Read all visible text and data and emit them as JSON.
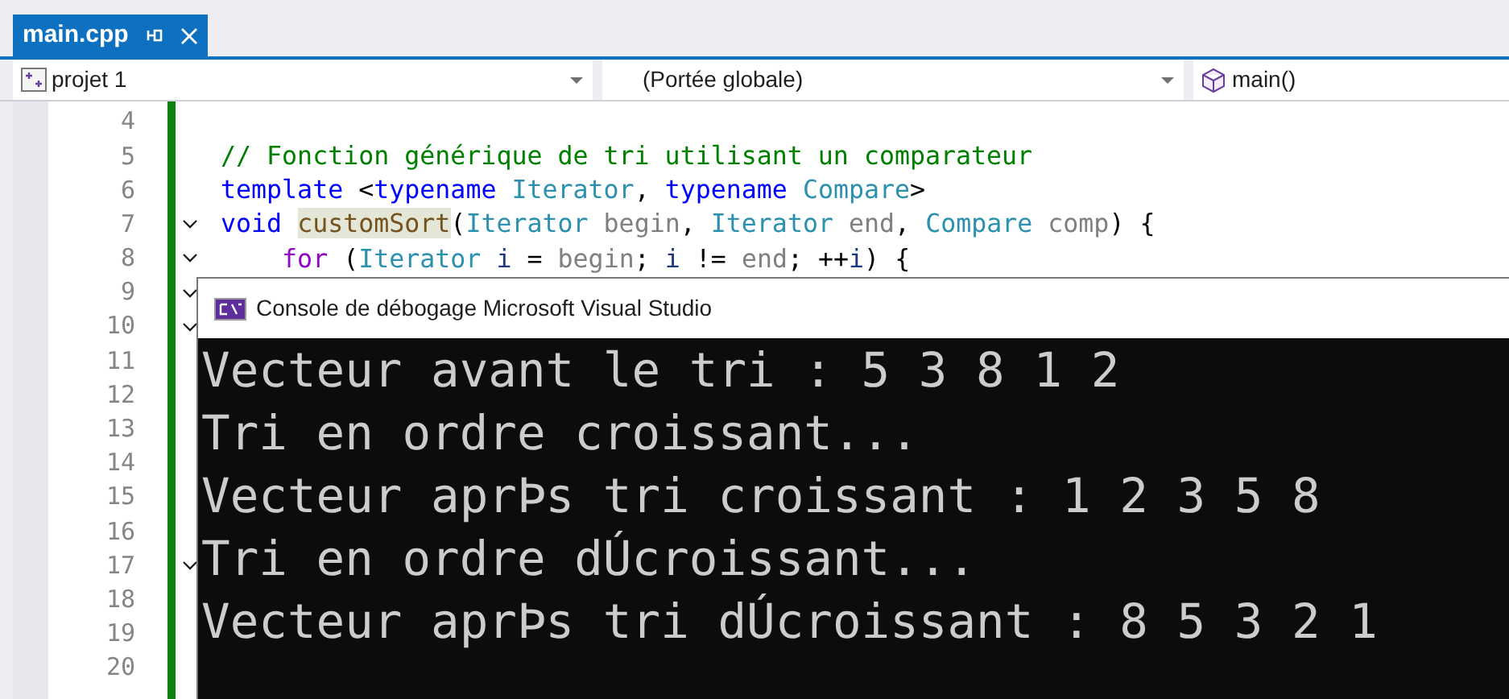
{
  "tab": {
    "label": "main.cpp",
    "selected": true
  },
  "nav": {
    "project": "projet 1",
    "scope": "(Portée globale)",
    "member": "main()"
  },
  "editor": {
    "lines": [
      {
        "number": "4",
        "foldable": false
      },
      {
        "number": "5",
        "foldable": false,
        "tokens": [
          {
            "kind": "comment",
            "text": "// Fonction générique de tri utilisant un comparateur"
          }
        ]
      },
      {
        "number": "6",
        "foldable": false,
        "tokens": [
          {
            "kind": "keyword",
            "text": "template"
          },
          {
            "kind": "plain",
            "text": " <"
          },
          {
            "kind": "keyword",
            "text": "typename "
          },
          {
            "kind": "type",
            "text": "Iterator"
          },
          {
            "kind": "plain",
            "text": ", "
          },
          {
            "kind": "keyword",
            "text": "typename "
          },
          {
            "kind": "type",
            "text": "Compare"
          },
          {
            "kind": "plain",
            "text": ">"
          }
        ]
      },
      {
        "number": "7",
        "foldable": true,
        "tokens": [
          {
            "kind": "keyword",
            "text": "void "
          },
          {
            "kind": "function",
            "text": "customSort"
          },
          {
            "kind": "plain",
            "text": "("
          },
          {
            "kind": "type",
            "text": "Iterator"
          },
          {
            "kind": "param",
            "text": " begin"
          },
          {
            "kind": "plain",
            "text": ", "
          },
          {
            "kind": "type",
            "text": "Iterator"
          },
          {
            "kind": "param",
            "text": " end"
          },
          {
            "kind": "plain",
            "text": ", "
          },
          {
            "kind": "type",
            "text": "Compare"
          },
          {
            "kind": "param",
            "text": " comp"
          },
          {
            "kind": "plain",
            "text": ") {"
          }
        ]
      },
      {
        "number": "8",
        "foldable": true,
        "tokens": [
          {
            "kind": "control",
            "text": "    for"
          },
          {
            "kind": "plain",
            "text": " ("
          },
          {
            "kind": "type",
            "text": "Iterator"
          },
          {
            "kind": "variable",
            "text": " i"
          },
          {
            "kind": "plain",
            "text": " = "
          },
          {
            "kind": "param",
            "text": "begin"
          },
          {
            "kind": "plain",
            "text": "; "
          },
          {
            "kind": "variable",
            "text": "i"
          },
          {
            "kind": "plain",
            "text": " != "
          },
          {
            "kind": "param",
            "text": "end"
          },
          {
            "kind": "plain",
            "text": "; ++"
          },
          {
            "kind": "variable",
            "text": "i"
          },
          {
            "kind": "plain",
            "text": ") {"
          }
        ]
      },
      {
        "number": "9",
        "foldable": true
      },
      {
        "number": "10",
        "foldable": true
      },
      {
        "number": "11",
        "foldable": false
      },
      {
        "number": "12",
        "foldable": false
      },
      {
        "number": "13",
        "foldable": false
      },
      {
        "number": "14",
        "foldable": false
      },
      {
        "number": "15",
        "foldable": false
      },
      {
        "number": "16",
        "foldable": false
      },
      {
        "number": "17",
        "foldable": true
      },
      {
        "number": "18",
        "foldable": false
      },
      {
        "number": "19",
        "foldable": false
      },
      {
        "number": "20",
        "foldable": false
      }
    ]
  },
  "console": {
    "title": "Console de débogage Microsoft Visual Studio",
    "lines": [
      "Vecteur avant le tri : 5 3 8 1 2",
      "Tri en ordre croissant...",
      "Vecteur aprÞs tri croissant : 1 2 3 5 8",
      "Tri en ordre dÚcroissant...",
      "Vecteur aprÞs tri dÚcroissant : 8 5 3 2 1"
    ]
  }
}
